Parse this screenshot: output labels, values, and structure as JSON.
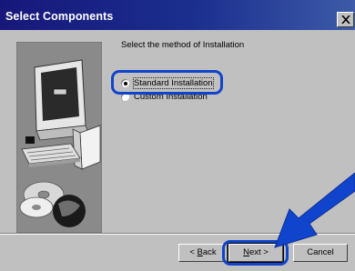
{
  "window": {
    "title": "Select Components"
  },
  "main": {
    "prompt": "Select the method of Installation",
    "options": [
      {
        "label": "Standard Installation",
        "selected": true
      },
      {
        "label": "Custom Installation",
        "selected": false
      }
    ]
  },
  "buttons": {
    "back_key": "B",
    "back_rest": "ack",
    "back_prefix": "< ",
    "next_key": "N",
    "next_rest": "ext >",
    "cancel": "Cancel"
  },
  "colors": {
    "titlebar_dark": "#17177a",
    "titlebar_light": "#3d5ba8",
    "dialog_face": "#c0c0c0",
    "callout": "#1144cc"
  }
}
